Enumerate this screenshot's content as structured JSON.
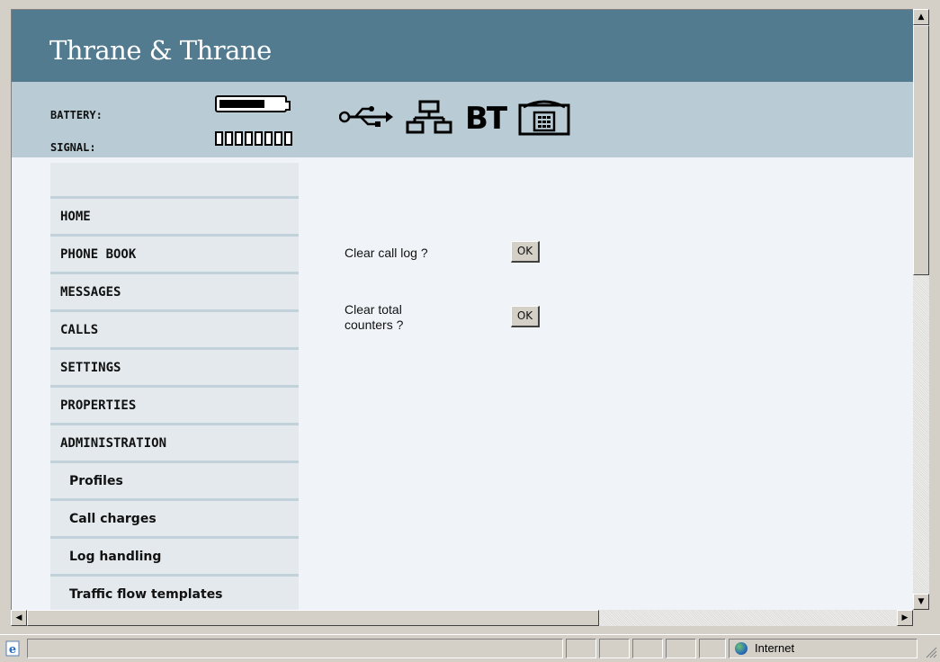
{
  "brand": "Thrane & Thrane",
  "status": {
    "battery_label": "BATTERY:",
    "signal_label": "SIGNAL:",
    "battery_level": 0.72,
    "signal_bars_total": 8,
    "icons": [
      "usb-icon",
      "lan-icon",
      "bluetooth-icon",
      "phone-icon"
    ],
    "bt_text": "BT"
  },
  "sidebar": {
    "items": [
      {
        "label": "HOME"
      },
      {
        "label": "PHONE BOOK"
      },
      {
        "label": "MESSAGES"
      },
      {
        "label": "CALLS"
      },
      {
        "label": "SETTINGS"
      },
      {
        "label": "PROPERTIES"
      },
      {
        "label": "ADMINISTRATION"
      },
      {
        "label": "Profiles"
      },
      {
        "label": "Call charges"
      },
      {
        "label": "Log handling"
      },
      {
        "label": "Traffic flow templates"
      }
    ]
  },
  "main": {
    "clear_call_log_label": "Clear call log ?",
    "clear_counters_line1": "Clear total",
    "clear_counters_line2": "counters ?",
    "ok_label": "OK"
  },
  "browser_status": {
    "zone": "Internet"
  }
}
